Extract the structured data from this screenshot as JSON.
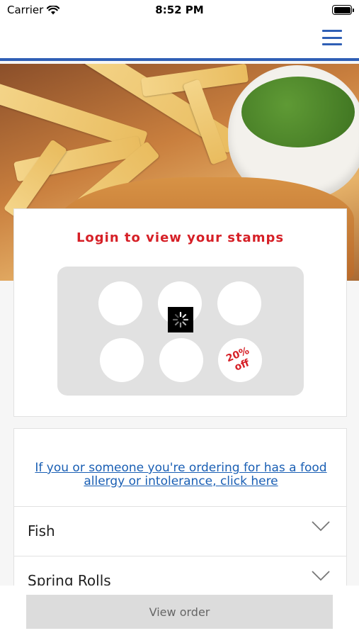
{
  "status_bar": {
    "carrier": "Carrier",
    "time": "8:52 PM"
  },
  "header": {
    "menu_icon": "hamburger-menu-icon",
    "accent": "#2f5fb5"
  },
  "stamp_card": {
    "title": "Login to view your stamps",
    "discount_line1": "20%",
    "discount_line2": "off",
    "accent": "#d62027"
  },
  "menu": {
    "allergy_link": "If you or someone you're ordering for has a food allergy or intolerance, click here",
    "categories": [
      {
        "label": "Fish"
      },
      {
        "label": "Spring Rolls"
      }
    ]
  },
  "footer": {
    "view_order_label": "View order"
  }
}
